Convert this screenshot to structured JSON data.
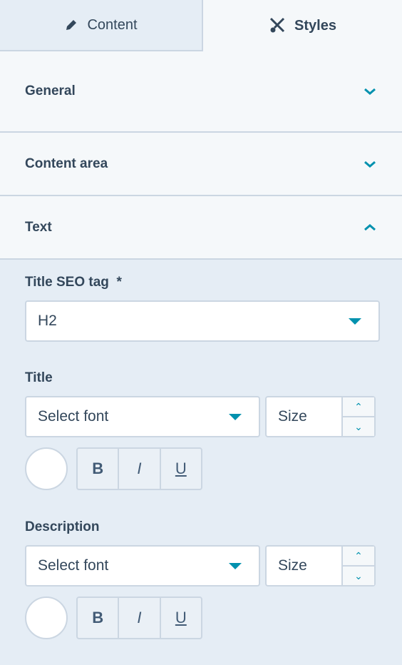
{
  "tabs": [
    {
      "label": "Content",
      "icon": "pencil-icon"
    },
    {
      "label": "Styles",
      "icon": "brush-icon"
    }
  ],
  "sections": [
    {
      "label": "General",
      "state": "collapsed"
    },
    {
      "label": "Content area",
      "state": "collapsed"
    },
    {
      "label": "Text",
      "state": "expanded"
    }
  ],
  "text": {
    "seo_label": "Title SEO tag",
    "required_mark": "*",
    "seo_value": "H2",
    "title_label": "Title",
    "title_font": "Select font",
    "title_size": "Size",
    "desc_label": "Description",
    "desc_font": "Select font",
    "desc_size": "Size",
    "bold": "B",
    "italic": "I",
    "underline": "U"
  },
  "colors": {
    "accent": "#0091ae",
    "border": "#cbd6e2"
  }
}
